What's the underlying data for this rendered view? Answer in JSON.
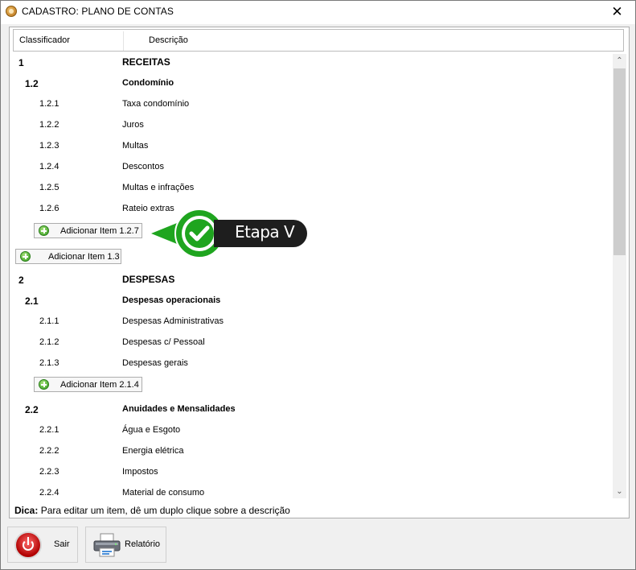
{
  "window": {
    "title": "CADASTRO: PLANO DE CONTAS",
    "close_glyph": "✕"
  },
  "table": {
    "headers": {
      "classificador": "Classificador",
      "descricao": "Descrição"
    },
    "rows": [
      {
        "code": "1",
        "desc": "RECEITAS"
      },
      {
        "code": "1.2",
        "desc": "Condomínio"
      },
      {
        "code": "1.2.1",
        "desc": "Taxa condomínio"
      },
      {
        "code": "1.2.2",
        "desc": "Juros"
      },
      {
        "code": "1.2.3",
        "desc": "Multas"
      },
      {
        "code": "1.2.4",
        "desc": "Descontos"
      },
      {
        "code": "1.2.5",
        "desc": "Multas e infrações"
      },
      {
        "code": "1.2.6",
        "desc": "Rateio extras"
      },
      {
        "code": "2",
        "desc": "DESPESAS"
      },
      {
        "code": "2.1",
        "desc": "Despesas operacionais"
      },
      {
        "code": "2.1.1",
        "desc": "Despesas Administrativas"
      },
      {
        "code": "2.1.2",
        "desc": "Despesas c/ Pessoal"
      },
      {
        "code": "2.1.3",
        "desc": "Despesas gerais"
      },
      {
        "code": "2.2",
        "desc": "Anuidades e Mensalidades"
      },
      {
        "code": "2.2.1",
        "desc": "Água e Esgoto"
      },
      {
        "code": "2.2.2",
        "desc": "Energia elétrica"
      },
      {
        "code": "2.2.3",
        "desc": "Impostos"
      },
      {
        "code": "2.2.4",
        "desc": "Material de consumo"
      }
    ],
    "add_buttons": {
      "item_127": "Adicionar Item 1.2.7",
      "item_13": "Adicionar Item 1.3",
      "item_214": "Adicionar Item 2.1.4"
    }
  },
  "scrollbar": {
    "up": "⌃",
    "down": "⌄"
  },
  "tip": {
    "label": "Dica:",
    "text": "Para editar um item, dê um duplo clique sobre a descrição"
  },
  "callout": {
    "text": "Etapa V",
    "color": "#1fa51f"
  },
  "footer": {
    "sair_label": "Sair",
    "relatorio_label": "Relatório"
  },
  "icons": {
    "app": "app-icon",
    "add": "add-circle-icon",
    "power": "power-icon",
    "printer": "printer-icon",
    "check": "check-icon"
  }
}
